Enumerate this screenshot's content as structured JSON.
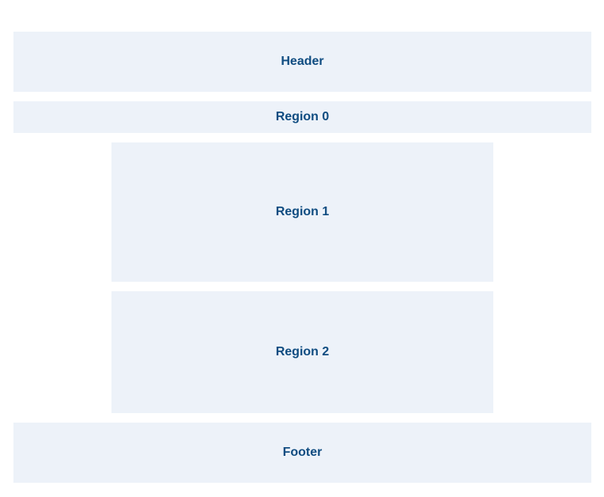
{
  "colors": {
    "region_fill": "#edf2f9",
    "label_text": "#0f4c81",
    "background": "#ffffff"
  },
  "layout": {
    "header": {
      "label": "Header"
    },
    "regions": [
      {
        "label": "Region 0"
      },
      {
        "label": "Region 1"
      },
      {
        "label": "Region 2"
      }
    ],
    "footer": {
      "label": "Footer"
    }
  }
}
